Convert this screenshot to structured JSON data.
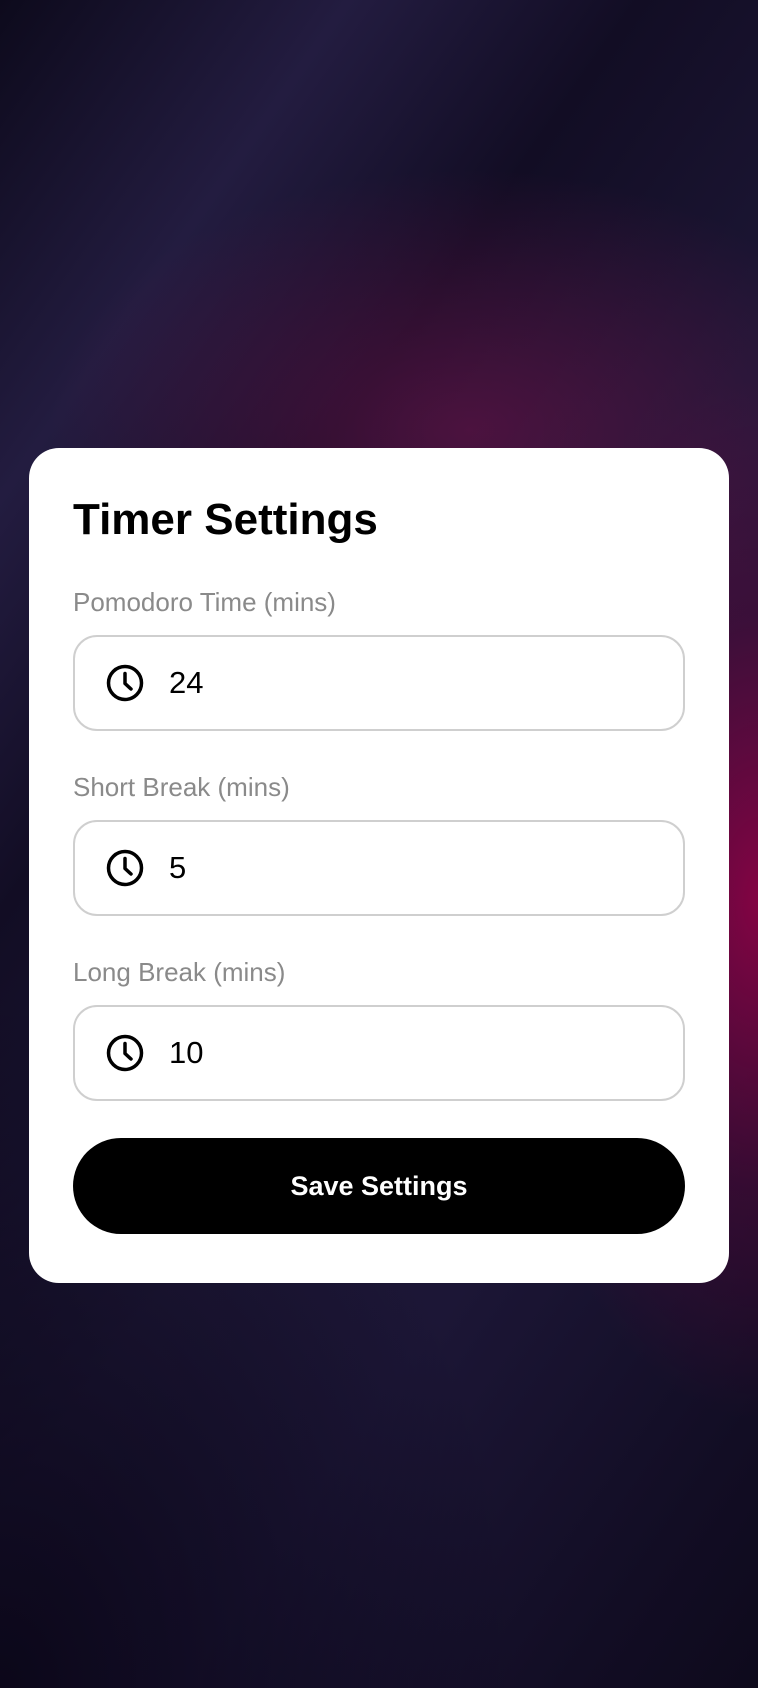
{
  "settings": {
    "title": "Timer Settings",
    "fields": [
      {
        "label": "Pomodoro Time (mins)",
        "value": "24",
        "icon": "clock-icon"
      },
      {
        "label": "Short Break (mins)",
        "value": "5",
        "icon": "clock-icon"
      },
      {
        "label": "Long Break (mins)",
        "value": "10",
        "icon": "clock-icon"
      }
    ],
    "save_label": "Save Settings"
  },
  "colors": {
    "card_background": "#ffffff",
    "label_color": "#8a8a8a",
    "field_border": "#cfcfcf",
    "button_background": "#000000",
    "button_text": "#ffffff",
    "accent_glow": "#96004a"
  }
}
